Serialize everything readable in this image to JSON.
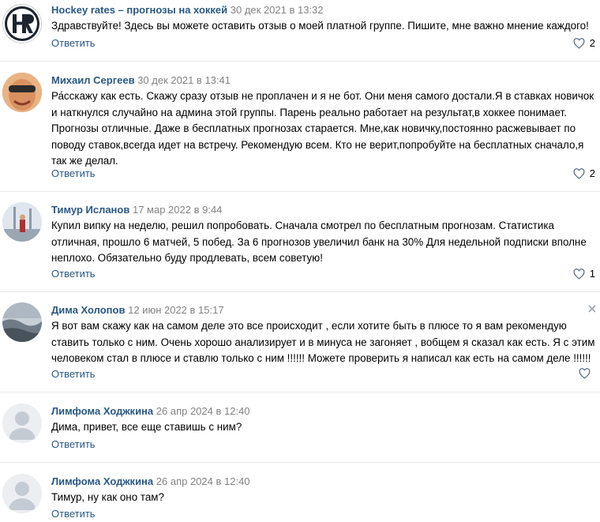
{
  "reply_label": "Ответить",
  "comments": [
    {
      "author": "Hockey rates – прогнозы на хоккей",
      "date": "30 дек 2021 в 13:32",
      "text": "Здравствуйте! Здесь вы можете оставить отзыв о моей платной группе. Пишите, мне важно мнение каждого!",
      "likes": "2",
      "avatar": "hr-logo"
    },
    {
      "author": "Михаил Сергеев",
      "date": "30 дек 2021 в 13:41",
      "text": "Ра́сскажу как есть. Скажу сразу отзыв не проплачен и я не бот. Они меня самого достали.Я в ставках новичок и наткнулся случайно на админа этой группы. Парень реально работает на результат,в хоккее понимает. Прогнозы отличные. Даже в бесплатных прогнозах старается. Мне,как новичку,постоянно расжевывает по поводу ставок,всегда идет на встречу. Рекомендую всем. Кто не верит,попробуйте на бесплатных сначало,я так же делал.",
      "likes": "2",
      "avatar": "user-photo"
    },
    {
      "author": "Тимур Исланов",
      "date": "17 мар 2022 в 9:44",
      "text": "Купил випку на неделю, решил попробовать. Сначала смотрел по бесплатным прогнозам. Статистика отличная, прошло 6 матчей, 5 побед. За 6 прогнозов увеличил банк на 30% Для недельной подписки вполне неплохо. Обязательно буду продлевать, всем советую!",
      "likes": "1",
      "avatar": "user-photo"
    },
    {
      "author": "Дима Холопов",
      "date": "12 июн 2022 в 15:17",
      "text": "Я вот вам скажу как на самом деле это все происходит , если хотите быть в плюсе то я вам рекомендую ставить только с ним. Очень хорошо анализирует и в минуса не загоняет , вобщем я сказал как есть. Я с этим человеком стал в плюсе и ставлю только с ним !!!!!! Можете проверить я написал как есть на самом деле !!!!!!",
      "likes": "",
      "avatar": "user-photo"
    },
    {
      "author": "Лимфома Ходжкина",
      "date": "26 апр 2024 в 12:40",
      "text": "Дима, привет, все еще ставишь с ним?",
      "likes": "",
      "avatar": "default-avatar"
    },
    {
      "author": "Лимфома Ходжкина",
      "date": "26 апр 2024 в 12:40",
      "text": "Тимур, ну как оно там?",
      "likes": "",
      "avatar": "default-avatar"
    }
  ]
}
